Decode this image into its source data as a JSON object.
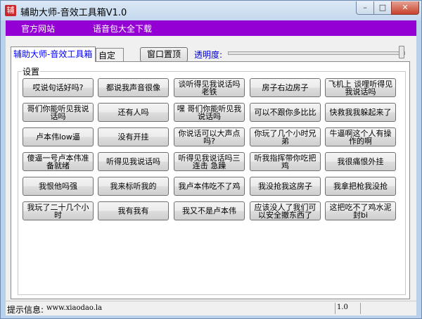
{
  "window": {
    "title": "辅助大师-音效工具箱V1.0",
    "app_icon": "辅"
  },
  "menubar": {
    "items": [
      "官方网站",
      "语音包大全下载"
    ]
  },
  "tabs": {
    "main": "辅助大师-音效工具箱",
    "custom": "自定义"
  },
  "toolbar": {
    "topmost_label": "窗口置顶",
    "opacity_label": "透明度:"
  },
  "group": {
    "label": "设置"
  },
  "sound_buttons": [
    "哎说句话好吗?",
    "都说我声音很像",
    "谈听得见我说话吗老铁",
    "房子右边房子",
    "飞机上 谈哩听得见我说话吗",
    "哥们你能听见我说话吗",
    "还有人吗",
    "嘿 哥们你能听见我说话吗",
    "可以不跟你多比比",
    "快救我我躲起来了",
    "卢本伟low逼",
    "没有开挂",
    "你说话可以大声点吗?",
    "你玩了几个小时兄弟",
    "牛逼啊这个人有操作的啊",
    "傻逼一号卢本伟准备就绪",
    "听得见我说话吗",
    "听得见我说话吗三连击 急躁",
    "听我指挥带你吃把鸡",
    "我很痛恨外挂",
    "我恨他吗强",
    "我来标听我的",
    "我卢本伟吃不了鸡",
    "我没抢我这房子",
    "我拿把枪我没抢",
    "我玩了二十几个小时",
    "我有我有",
    "我又不是卢本伟",
    "应该没人了我们可以安全撤东西了",
    "这把吃不了鸡水泥封bi"
  ],
  "statusbar": {
    "label": "提示信息:",
    "value": "www.xiaodao.la",
    "version": "1.0"
  }
}
